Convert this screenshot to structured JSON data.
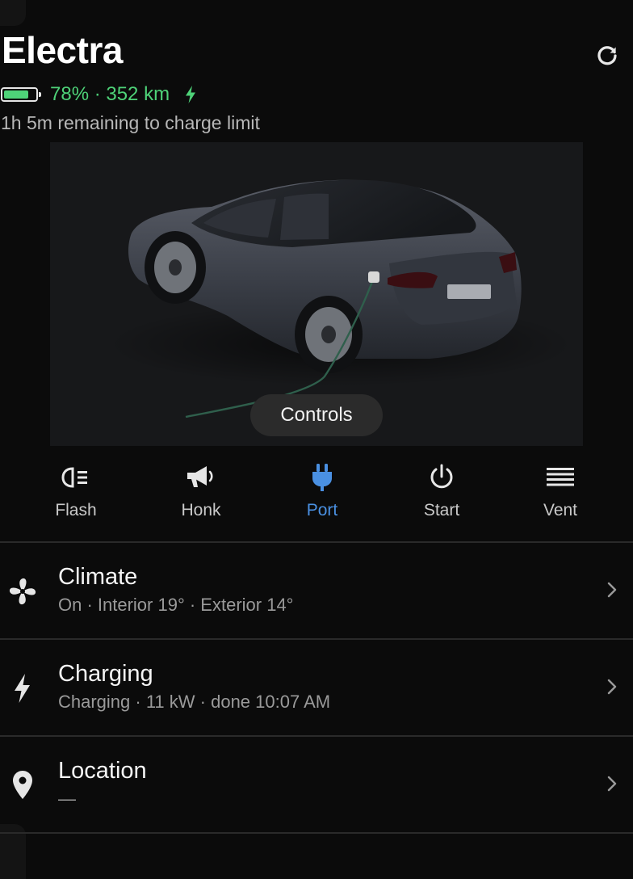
{
  "vehicle": {
    "name": "Electra",
    "battery_percent": 78,
    "battery_text": "78% · 352 km",
    "charge_note": "1h 5m remaining to charge limit"
  },
  "car_panel": {
    "controls_label": "Controls"
  },
  "actions": [
    {
      "label": "Flash",
      "icon": "headlight-icon",
      "active": false
    },
    {
      "label": "Honk",
      "icon": "horn-icon",
      "active": false
    },
    {
      "label": "Port",
      "icon": "plug-icon",
      "active": true
    },
    {
      "label": "Start",
      "icon": "power-icon",
      "active": false
    },
    {
      "label": "Vent",
      "icon": "vent-icon",
      "active": false
    }
  ],
  "sections": [
    {
      "title": "Climate",
      "subtitle": "On · Interior 19° · Exterior 14°",
      "icon": "fan-icon"
    },
    {
      "title": "Charging",
      "subtitle": "Charging · 11 kW · done 10:07 AM",
      "icon": "bolt-icon"
    },
    {
      "title": "Location",
      "subtitle": "—",
      "icon": "location-pin-icon"
    }
  ],
  "colors": {
    "background": "#0b0b0b",
    "accent_green": "#4ed278",
    "accent_blue": "#4a90e2",
    "muted_text": "#9a9a9a"
  }
}
